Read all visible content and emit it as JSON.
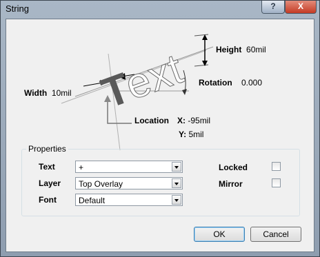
{
  "window": {
    "title": "String"
  },
  "titlebar": {
    "help_label": "?",
    "close_label": "X"
  },
  "diagram": {
    "sample_text": "Text",
    "height_label": "Height",
    "height_value": "60mil",
    "rotation_label": "Rotation",
    "rotation_value": "0.000",
    "width_label": "Width",
    "width_value": "10mil",
    "location_label": "Location",
    "x_label": "X:",
    "x_value": "-95mil",
    "y_label": "Y:",
    "y_value": "5mil"
  },
  "properties": {
    "group_title": "Properties",
    "text_label": "Text",
    "text_value": "+",
    "layer_label": "Layer",
    "layer_value": "Top Overlay",
    "font_label": "Font",
    "font_value": "Default",
    "locked_label": "Locked",
    "locked_checked": false,
    "mirror_label": "Mirror",
    "mirror_checked": false
  },
  "buttons": {
    "ok_label": "OK",
    "cancel_label": "Cancel"
  },
  "colors": {
    "window_frame": "#a9b7c6",
    "close_red": "#c43b24",
    "client_bg": "#f0f0f0"
  }
}
